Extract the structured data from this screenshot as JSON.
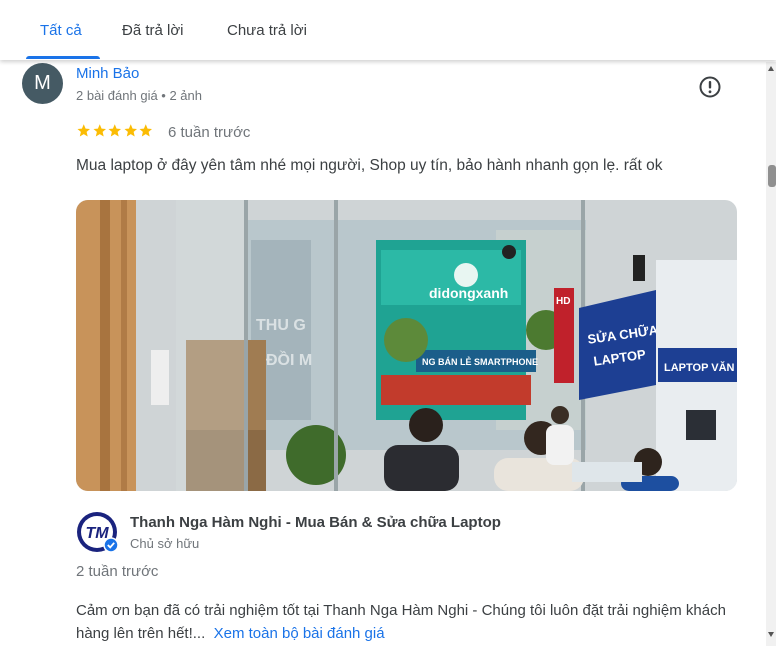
{
  "tabs": [
    {
      "label": "Tất cả",
      "active": true
    },
    {
      "label": "Đã trả lời",
      "active": false
    },
    {
      "label": "Chưa trả lời",
      "active": false
    }
  ],
  "review": {
    "avatar_letter": "M",
    "avatar_color": "#455a64",
    "author": "Minh Bảo",
    "meta": "2 bài đánh giá • 2 ảnh",
    "rating": 5,
    "rating_max": 5,
    "time": "6 tuần trước",
    "text": "Mua laptop ở đây yên tâm nhé mọi người, Shop uy tín, bảo hành nhanh gọn lẹ. rất ok",
    "photo": {
      "store_sign": "didongxanh",
      "store_banner": "NG BÁN LẺ SMARTPHONE",
      "repair_sign_line1": "SỬA CHỮA",
      "repair_sign_line2": "LAPTOP",
      "laptop_sign": "LAPTOP VĂN PH",
      "glass_text_1": "THU G",
      "glass_text_2": "ĐỒI M",
      "hd_sign": "HD"
    }
  },
  "owner_reply": {
    "logo_text": "TM",
    "name": "Thanh Nga Hàm Nghi - Mua Bán & Sửa chữa Laptop",
    "role": "Chủ sở hữu",
    "time": "2 tuần trước",
    "text": "Cảm ơn bạn đã có trải nghiệm tốt tại Thanh Nga Hàm Nghi - Chúng tôi luôn đặt trải nghiệm khách hàng lên trên hết!...",
    "see_more": "Xem toàn bộ bài đánh giá"
  },
  "colors": {
    "accent": "#1a73e8",
    "star": "#fbbc04",
    "secondary_text": "#70757a"
  },
  "icons": {
    "report": "alert-circle-icon",
    "verified": "verified-check-icon",
    "star": "star-icon"
  }
}
